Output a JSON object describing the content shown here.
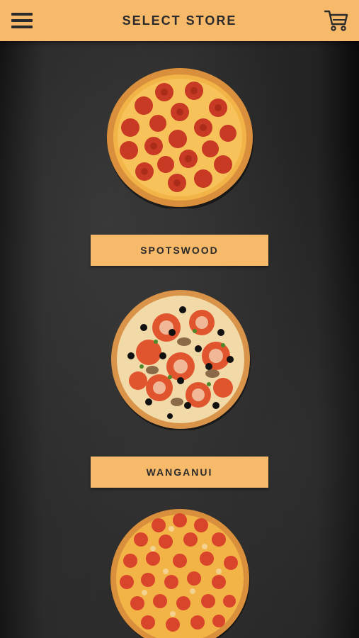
{
  "header": {
    "title": "SELECT STORE",
    "menu_icon": "hamburger-menu-icon",
    "cart_icon": "shopping-cart-icon",
    "background_color": "#f7b96a"
  },
  "stores": [
    {
      "name": "SPOTSWOOD",
      "image": "pepperoni-pizza"
    },
    {
      "name": "WANGANUI",
      "image": "vegetarian-pizza"
    },
    {
      "name": "",
      "image": "supreme-pizza"
    }
  ],
  "colors": {
    "accent": "#f7b96a",
    "text": "#2b2b2b",
    "background": "#1e1e1e"
  }
}
